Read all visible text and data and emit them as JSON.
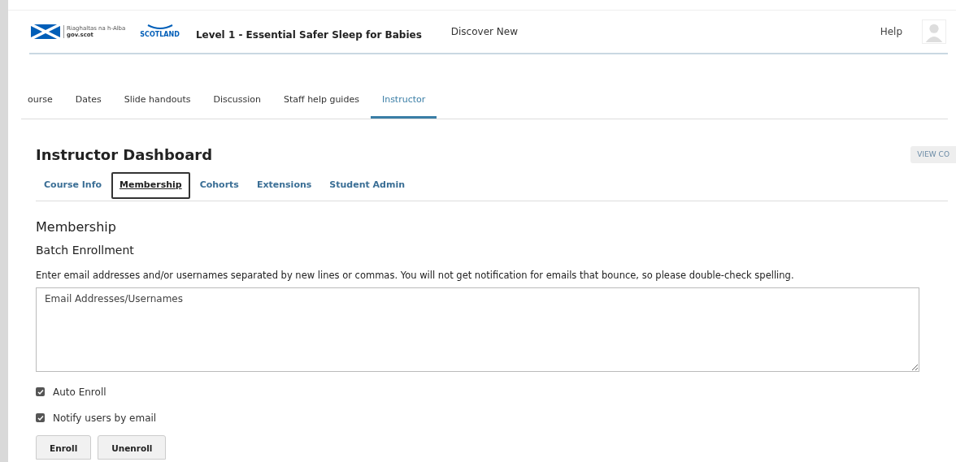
{
  "header": {
    "logo_lines": [
      "Riaghaltas na h-Alba",
      "gov.scot"
    ],
    "nhs_label": "SCOTLAND",
    "course_title": "Level 1 - Essential Safer Sleep for Babies",
    "nav_link": "Discover New",
    "help": "Help"
  },
  "course_tabs": [
    {
      "label": "ourse",
      "selected": false
    },
    {
      "label": "Dates",
      "selected": false
    },
    {
      "label": "Slide handouts",
      "selected": false
    },
    {
      "label": "Discussion",
      "selected": false
    },
    {
      "label": "Staff help guides",
      "selected": false
    },
    {
      "label": "Instructor",
      "selected": true
    }
  ],
  "dashboard": {
    "title": "Instructor Dashboard",
    "view_button": "VIEW CO"
  },
  "dashboard_tabs": [
    {
      "label": "Course Info",
      "selected": false
    },
    {
      "label": "Membership",
      "selected": true
    },
    {
      "label": "Cohorts",
      "selected": false
    },
    {
      "label": "Extensions",
      "selected": false
    },
    {
      "label": "Student Admin",
      "selected": false
    }
  ],
  "membership": {
    "heading": "Membership",
    "subheading": "Batch Enrollment",
    "instructions": "Enter email addresses and/or usernames separated by new lines or commas. You will not get notification for emails that bounce, so please double-check spelling.",
    "placeholder": "Email Addresses/Usernames"
  },
  "options": [
    {
      "label": "Auto Enroll",
      "checked": true
    },
    {
      "label": "Notify users by email",
      "checked": true
    }
  ],
  "buttons": [
    "Enroll",
    "Unenroll"
  ]
}
